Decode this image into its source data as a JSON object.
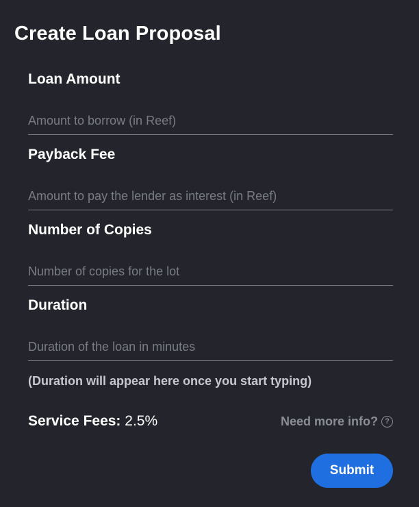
{
  "form": {
    "title": "Create Loan Proposal",
    "fields": [
      {
        "label": "Loan Amount",
        "placeholder": "Amount to borrow (in Reef)",
        "value": ""
      },
      {
        "label": "Payback Fee",
        "placeholder": "Amount to pay the lender as interest (in Reef)",
        "value": ""
      },
      {
        "label": "Number of Copies",
        "placeholder": "Number of copies for the lot",
        "value": ""
      },
      {
        "label": "Duration",
        "placeholder": "Duration of the loan in minutes",
        "value": ""
      }
    ],
    "duration_hint": "(Duration will appear here once you start typing)",
    "service_fees": {
      "label": "Service Fees:",
      "value": "2.5%"
    },
    "info_link": {
      "label": "Need more info?",
      "icon": "question-circle-icon"
    },
    "submit_label": "Submit"
  },
  "colors": {
    "background": "#24252c",
    "accent": "#1f6fe0",
    "text": "#ffffff",
    "muted": "#8b8d95"
  }
}
